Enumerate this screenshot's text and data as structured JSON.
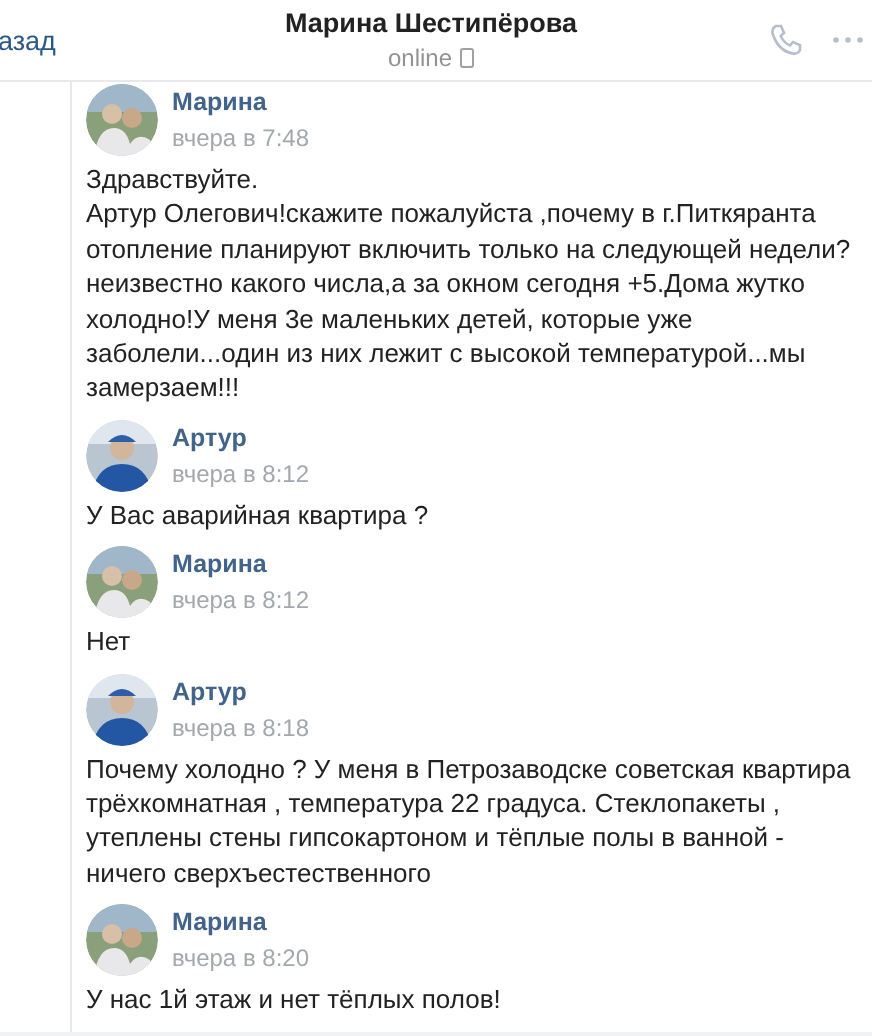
{
  "header": {
    "back": "азад",
    "title": "Марина Шестипёрова",
    "status": "online"
  },
  "messages": [
    {
      "author": "Марина",
      "time": "вчера в 7:48",
      "text": [
        "Здравствуйте.",
        "Артур Олегович!скажите пожалуйста ,почему в г.Питкяранта отопление планируют включить только на следующей недели?неизвестно какого числа,а за окном сегодня +5.Дома жутко холодно!У меня 3е маленьких детей, которые уже заболели...один из них лежит с высокой температурой...мы замерзаем!!!"
      ]
    },
    {
      "author": "Артур",
      "time": "вчера в 8:12",
      "text": [
        "У Вас аварийная квартира ?"
      ]
    },
    {
      "author": "Марина",
      "time": "вчера в 8:12",
      "text": [
        "Нет"
      ]
    },
    {
      "author": "Артур",
      "time": "вчера в 8:18",
      "text": [
        "Почему холодно ? У меня в Петрозаводске советская квартира трёхкомнатная , температура 22 градуса. Стеклопакеты , утеплены стены гипсокартоном и тёплые полы в ванной - ничего сверхъестественного"
      ]
    },
    {
      "author": "Марина",
      "time": "вчера в 8:20",
      "text": [
        "У нас 1й этаж и нет тёплых полов!"
      ]
    }
  ]
}
